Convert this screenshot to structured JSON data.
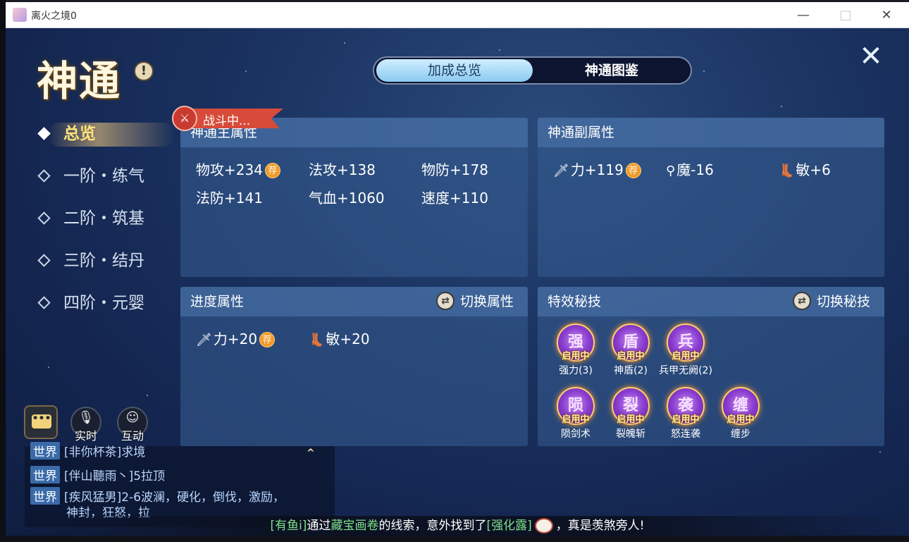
{
  "window": {
    "title": "离火之境0",
    "controls": {
      "minimize": "—",
      "maximize": "□",
      "close": "✕"
    }
  },
  "header": {
    "title": "神通",
    "info_icon": "!",
    "tabs": [
      {
        "label": "加成总览",
        "active": true
      },
      {
        "label": "神通图鉴",
        "active": false
      }
    ],
    "close_icon": "close-icon"
  },
  "sidebar": {
    "items": [
      {
        "label": "总览",
        "active": true
      },
      {
        "label": "一阶・练气",
        "active": false
      },
      {
        "label": "二阶・筑基",
        "active": false
      },
      {
        "label": "三阶・结丹",
        "active": false
      },
      {
        "label": "四阶・元婴",
        "active": false
      }
    ]
  },
  "combat_badge": {
    "text": "战斗中..."
  },
  "main_attr": {
    "title": "神通主属性",
    "stats": [
      {
        "text": "物攻+234",
        "recommend": "荐"
      },
      {
        "text": "法攻+138"
      },
      {
        "text": "物防+178"
      },
      {
        "text": "法防+141"
      },
      {
        "text": "气血+1060"
      },
      {
        "text": "速度+110"
      }
    ]
  },
  "sub_attr": {
    "title": "神通副属性",
    "stats": [
      {
        "icon": "sword-icon",
        "text": "力+119",
        "recommend": "荐"
      },
      {
        "icon": "wand-icon",
        "text": "魔-16"
      },
      {
        "icon": "boot-icon",
        "text": "敏+6"
      }
    ]
  },
  "progress_attr": {
    "title": "进度属性",
    "switch_label": "切换属性",
    "stats": [
      {
        "icon": "sword-icon",
        "text": "力+20",
        "recommend": "荐"
      },
      {
        "icon": "boot-icon",
        "text": "敏+20"
      }
    ]
  },
  "special_skills": {
    "title": "特效秘技",
    "switch_label": "切换秘技",
    "skills": [
      {
        "glyph": "强",
        "status": "启用中",
        "name": "强力(3)"
      },
      {
        "glyph": "盾",
        "status": "启用中",
        "name": "神盾(2)"
      },
      {
        "glyph": "兵",
        "status": "启用中",
        "name": "兵甲无阙(2)"
      },
      {
        "glyph": "陨",
        "status": "启用中",
        "name": "陨剑术"
      },
      {
        "glyph": "裂",
        "status": "启用中",
        "name": "裂魄斩"
      },
      {
        "glyph": "袭",
        "status": "启用中",
        "name": "怒连袭"
      },
      {
        "glyph": "缠",
        "status": "启用中",
        "name": "缠步"
      }
    ]
  },
  "chat": {
    "buttons": {
      "realtime": "实时",
      "interact": "互动",
      "chat_symbol": "•••"
    },
    "lines": [
      {
        "channel": "世界",
        "text": "[非你杯茶]求境"
      },
      {
        "channel": "世界",
        "text": "[伴山聽雨丶]5拉顶"
      },
      {
        "channel": "世界",
        "text": "[疾风猛男]2-6波澜，硬化，倒伐，激励，",
        "wrap": "神封，狂怒，拉"
      }
    ],
    "collapse_icon": "^"
  },
  "ticker": {
    "player": "[有鱼i]",
    "part1": "通过",
    "item1": "藏宝画卷",
    "part2": "的线索，意外找到了",
    "item2": "[强化露]",
    "part3": "，真是羡煞旁人!"
  },
  "colors": {
    "accent_gold": "#ffe27a",
    "tab_active": "#8ccaf0",
    "panel_bg": "#34588c",
    "recommend_badge": "#f09a2a",
    "skill_orb": "#8a3ed0",
    "ticker_highlight": "#7ee08a"
  }
}
